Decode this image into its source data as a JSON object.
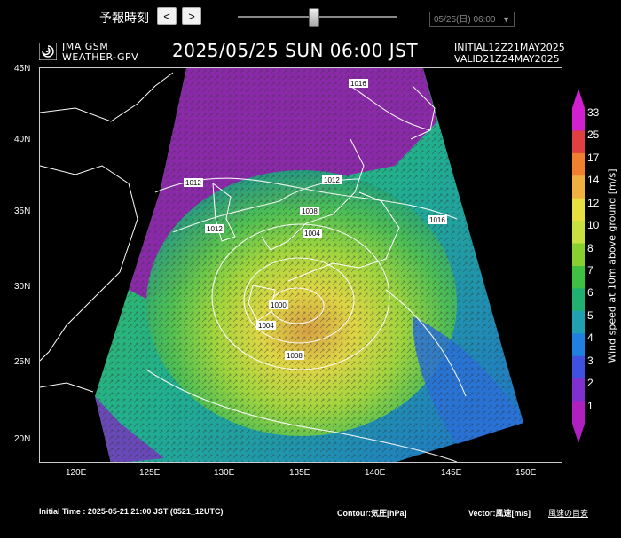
{
  "controls": {
    "forecast_label": "予報時刻",
    "prev_label": "<",
    "next_label": ">",
    "slider_position": 0.47,
    "selected_time": "05/25(日) 06:00"
  },
  "header": {
    "logo_line1": "JMA GSM",
    "logo_line2": "WEATHER-GPV",
    "title": "2025/05/25 SUN 06:00 JST",
    "initial": "INITIAL12Z21MAY2025",
    "valid": "VALID21Z24MAY2025"
  },
  "axes": {
    "lat_labels": [
      "45N",
      "40N",
      "35N",
      "30N",
      "25N",
      "20N"
    ],
    "lon_labels": [
      "120E",
      "125E",
      "130E",
      "135E",
      "140E",
      "145E",
      "150E"
    ]
  },
  "isobars": [
    "1016",
    "1012",
    "1012",
    "1012",
    "1008",
    "1004",
    "1000",
    "1004",
    "1008",
    "1016"
  ],
  "colorbar": {
    "title": "Wind speed at 10m above ground [m/s]",
    "ticks": [
      "33",
      "25",
      "17",
      "14",
      "12",
      "10",
      "8",
      "7",
      "6",
      "5",
      "4",
      "3",
      "2",
      "1"
    ],
    "colors": [
      "#d020d0",
      "#e04040",
      "#f08030",
      "#f0b040",
      "#e8e040",
      "#c8e040",
      "#88d030",
      "#40c040",
      "#20b070",
      "#20a0b0",
      "#2080e0",
      "#4050e0",
      "#8030d0",
      "#b020c0"
    ]
  },
  "footer": {
    "initial_time": "Initial Time : 2025-05-21 21:00 JST (0521_12UTC)",
    "contour": "Contour:気圧[hPa]",
    "vector": "Vector:風速[m/s]",
    "link": "風速の目安"
  }
}
